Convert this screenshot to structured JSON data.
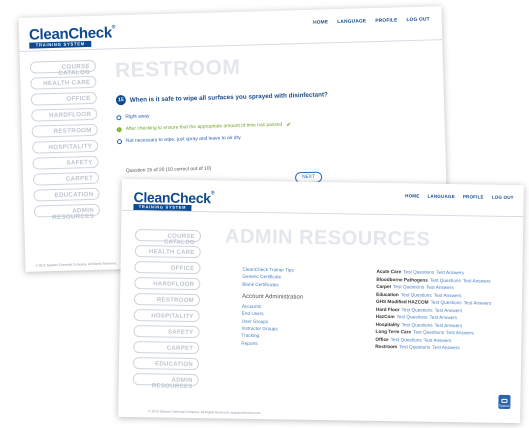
{
  "brand": {
    "name": "CleanCheck",
    "reg": "®",
    "tagline": "TRAINING SYSTEM"
  },
  "topnav": [
    "HOME",
    "LANGUAGE",
    "PROFILE",
    "LOG OUT"
  ],
  "sidenav": [
    "COURSE CATALOG",
    "HEALTH CARE",
    "OFFICE",
    "HARDFLOOR",
    "RESTROOM",
    "HOSPITALITY",
    "SAFETY",
    "CARPET",
    "EDUCATION",
    "ADMIN RESOURCES"
  ],
  "quiz": {
    "heading": "RESTROOM",
    "number": "15",
    "question": "When is it safe to wipe all surfaces you sprayed with disinfectant?",
    "answers": [
      {
        "text": "Right away",
        "selected": false
      },
      {
        "text": "After checking to ensure that the appropriate amount of time has passed",
        "selected": true
      },
      {
        "text": "Not necessary to wipe, just spray and leave to air dry.",
        "selected": false
      }
    ],
    "progress": "Question 15 of 20 (10 correct out of 10)",
    "next_label": "NEXT",
    "footer": "© 2015 Spartan Chemical Company. All Rights Reserved."
  },
  "admin": {
    "heading": "ADMIN RESOURCES",
    "links": [
      "CleanCheck Trainer Tips",
      "Generic Certificate",
      "Blank Certificates"
    ],
    "account_admin_title": "Account Administration",
    "account_links": [
      "Accounts",
      "End Users",
      "User Groups",
      "Instructor Groups",
      "Tracking",
      "Reports"
    ],
    "tests": [
      {
        "category": "Acute Care",
        "a": "Test Questions",
        "b": "Test Answers"
      },
      {
        "category": "Bloodborne Pathogens",
        "a": "Test Questions",
        "b": "Test Answers"
      },
      {
        "category": "Carpet",
        "a": "Test Questions",
        "b": "Test Answers"
      },
      {
        "category": "Education",
        "a": "Test Questions",
        "b": "Test Answers"
      },
      {
        "category": "GHS Modified HAZCOM",
        "a": "Test Questions",
        "b": "Test Answers"
      },
      {
        "category": "Hard Floor",
        "a": "Test Questions",
        "b": "Test Answers"
      },
      {
        "category": "HazCom",
        "a": "Test Questions",
        "b": "Test Answers"
      },
      {
        "category": "Hospitality",
        "a": "Test Questions",
        "b": "Test Answers"
      },
      {
        "category": "Long Term Care",
        "a": "Test Questions",
        "b": "Test Answers"
      },
      {
        "category": "Office",
        "a": "Test Questions",
        "b": "Test Answers"
      },
      {
        "category": "Restroom",
        "a": "Test Questions",
        "b": "Test Answers"
      }
    ],
    "footer": "© 2015 Spartan Chemical Company. All Rights Reserved. spartanchemical.com",
    "chat_label": "Spartan"
  }
}
